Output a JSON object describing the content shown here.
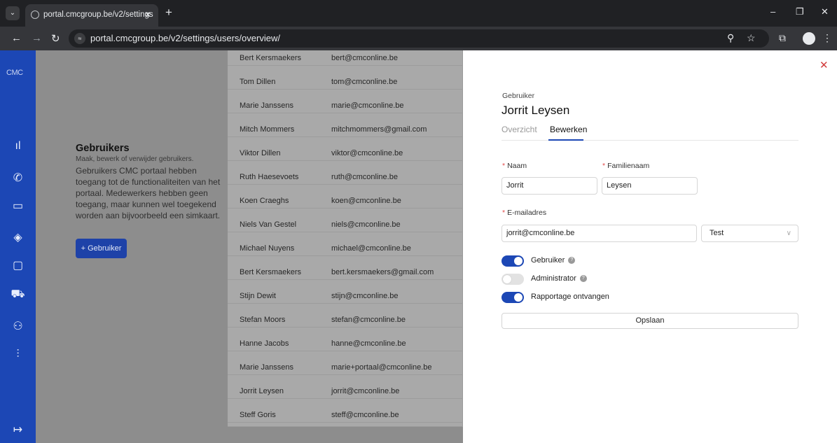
{
  "browser": {
    "tab_title": "portal.cmcgroup.be/v2/settings",
    "tab_menu_glyph": "⌄",
    "new_tab_glyph": "+",
    "url": "portal.cmcgroup.be/v2/settings/users/overview/",
    "glyphs": {
      "back": "←",
      "forward": "→",
      "reload": "↻",
      "close": "✕",
      "minimize": "–",
      "restore": "❐",
      "zoom": "⚲",
      "star": "☆",
      "extensions": "⧉",
      "menu": "⋮",
      "site_info": "≈"
    }
  },
  "sidebar": {
    "logo_text": "CMC",
    "icons": [
      "chart-bars-icon",
      "phone-icon",
      "monitor-icon",
      "layers-icon",
      "chat-icon",
      "cart-icon",
      "users-icon",
      "sliders-icon"
    ],
    "glyphs": [
      "ıl",
      "✆",
      "▭",
      "◈",
      "▢",
      "⛟",
      "⚇",
      "⫶"
    ],
    "logout_glyph": "↦"
  },
  "intro": {
    "title": "Gebruikers",
    "subtitle": "Maak, bewerk of verwijder gebruikers.",
    "text": "Gebruikers CMC portaal hebben toegang tot de functionaliteiten van het portaal. Medewerkers hebben geen toegang, maar kunnen wel toegekend worden aan bijvoorbeeld een simkaart.",
    "add_button": "+ Gebruiker"
  },
  "users": [
    {
      "name": "Bert Kersmaekers",
      "email": "bert@cmconline.be"
    },
    {
      "name": "Tom Dillen",
      "email": "tom@cmconline.be"
    },
    {
      "name": "Marie Janssens",
      "email": "marie@cmconline.be"
    },
    {
      "name": "Mitch Mommers",
      "email": "mitchmommers@gmail.com"
    },
    {
      "name": "Viktor Dillen",
      "email": "viktor@cmconline.be"
    },
    {
      "name": "Ruth Haesevoets",
      "email": "ruth@cmconline.be"
    },
    {
      "name": "Koen Craeghs",
      "email": "koen@cmconline.be"
    },
    {
      "name": "Niels Van Gestel",
      "email": "niels@cmconline.be"
    },
    {
      "name": "Michael Nuyens",
      "email": "michael@cmconline.be"
    },
    {
      "name": "Bert Kersmaekers",
      "email": "bert.kersmaekers@gmail.com"
    },
    {
      "name": "Stijn Dewit",
      "email": "stijn@cmconline.be"
    },
    {
      "name": "Stefan Moors",
      "email": "stefan@cmconline.be"
    },
    {
      "name": "Hanne Jacobs",
      "email": "hanne@cmconline.be"
    },
    {
      "name": "Marie Janssens",
      "email": "marie+portaal@cmconline.be"
    },
    {
      "name": "Jorrit Leysen",
      "email": "jorrit@cmconline.be"
    },
    {
      "name": "Steff Goris",
      "email": "steff@cmconline.be"
    }
  ],
  "drawer": {
    "close_glyph": "✕",
    "eyebrow": "Gebruiker",
    "title": "Jorrit Leysen",
    "tabs": [
      "Overzicht",
      "Bewerken"
    ],
    "active_tab": "Bewerken",
    "form": {
      "required_mark": "*",
      "first_name_label": "Naam",
      "first_name_value": "Jorrit",
      "last_name_label": "Familienaam",
      "last_name_value": "Leysen",
      "email_label": "E-mailadres",
      "email_value": "jorrit@cmconline.be",
      "select_value": "Test",
      "select_arrow": "∨",
      "help_glyph": "?",
      "toggles": [
        {
          "label": "Gebruiker",
          "on": true,
          "help": true
        },
        {
          "label": "Administrator",
          "on": false,
          "help": true
        },
        {
          "label": "Rapportage ontvangen",
          "on": true,
          "help": false
        }
      ],
      "save_label": "Opslaan"
    }
  },
  "colors": {
    "brand": "#1c47b5",
    "close": "#d23b3b",
    "required": "#e24c4c"
  }
}
